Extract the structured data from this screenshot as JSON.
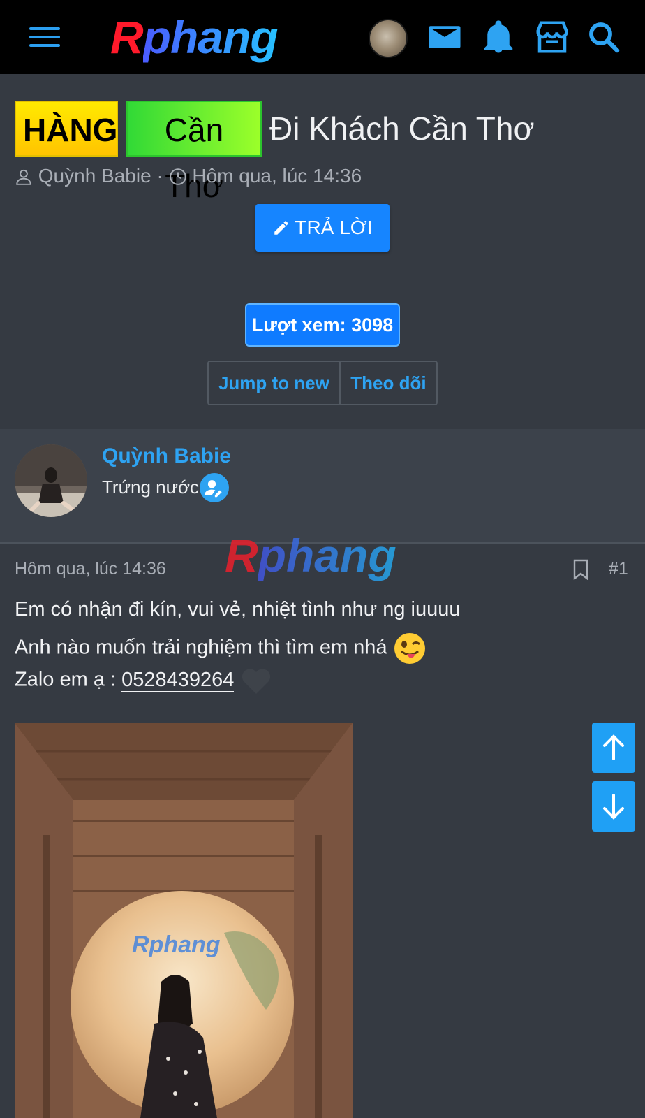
{
  "header": {
    "logo_r": "R",
    "logo_rest": "phang",
    "icons": [
      "menu-icon",
      "avatar",
      "mail-icon",
      "bell-icon",
      "store-icon",
      "search-icon"
    ]
  },
  "thread": {
    "tag1": "HÀNG",
    "tag2": "Cần Thơ",
    "title": "Đi Khách Cần Thơ",
    "author": "Quỳnh Babie",
    "separator": "·",
    "time": "Hôm qua, lúc 14:36",
    "reply_label": "TRẢ LỜI",
    "views_label": "Lượt xem: 3098",
    "jump_label": "Jump to new",
    "follow_label": "Theo dõi"
  },
  "post": {
    "author": "Quỳnh Babie",
    "rank": "Trứng nước",
    "watermark_r": "R",
    "watermark_rest": "phang",
    "date": "Hôm qua, lúc 14:36",
    "number": "#1",
    "line1": "Em có nhận đi kín, vui vẻ, nhiệt tình như ng iuuuu",
    "line2": "Anh nào muốn trải nghiệm thì tìm em nhá",
    "line3_prefix": "Zalo em ạ : ",
    "phone": "0528439264",
    "image_watermark": "Rphang"
  },
  "colors": {
    "accent": "#2ea3f2",
    "button": "#1685ff",
    "background": "#353a42",
    "header": "#000000"
  }
}
